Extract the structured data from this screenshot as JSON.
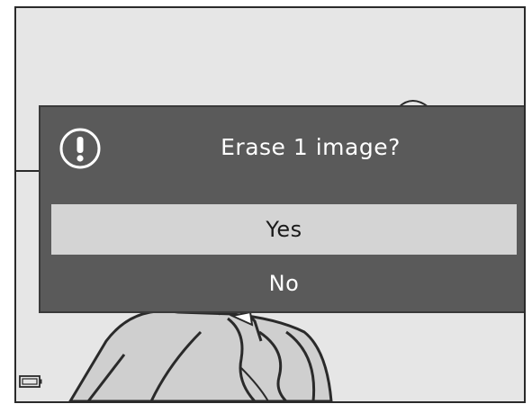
{
  "dialog": {
    "title": "Erase 1 image?",
    "icon": "warning-icon",
    "options": [
      {
        "label": "Yes",
        "selected": true
      },
      {
        "label": "No",
        "selected": false
      }
    ]
  },
  "status": {
    "battery_icon": "battery-icon"
  },
  "colors": {
    "dialog_bg": "#5a5a5a",
    "selected_bg": "#d4d4d4",
    "screen_bg": "#e6e6e6"
  }
}
